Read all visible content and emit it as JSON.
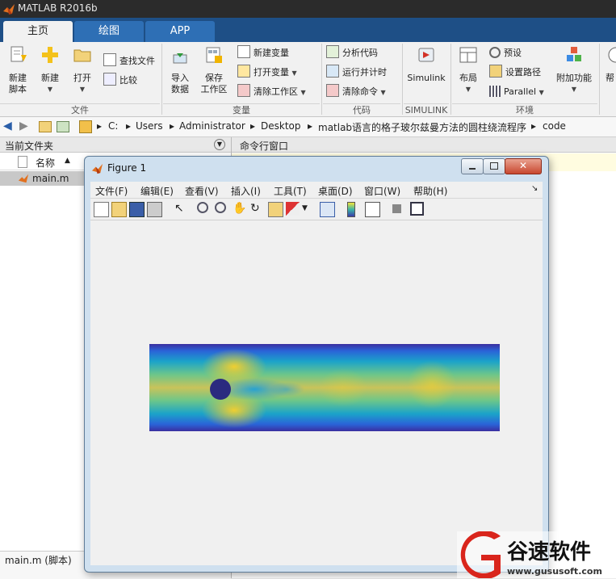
{
  "window": {
    "title": "MATLAB R2016b"
  },
  "tabs": [
    {
      "label": "主页",
      "active": true
    },
    {
      "label": "绘图",
      "active": false
    },
    {
      "label": "APP",
      "active": false
    }
  ],
  "ribbon": {
    "file": {
      "section_label": "文件",
      "new_script": [
        "新建",
        "脚本"
      ],
      "new": "新建",
      "open": "打开",
      "find_files": "查找文件",
      "compare": "比较"
    },
    "variable": {
      "section_label": "变量",
      "import_data": [
        "导入",
        "数据"
      ],
      "save_workspace": [
        "保存",
        "工作区"
      ],
      "new_variable": "新建变量",
      "open_variable": "打开变量",
      "clear_workspace": "清除工作区"
    },
    "code": {
      "section_label": "代码",
      "analyze_code": "分析代码",
      "run_and_time": "运行并计时",
      "clear_commands": "清除命令"
    },
    "simulink": {
      "section_label": "SIMULINK",
      "label": "Simulink"
    },
    "environment": {
      "section_label": "环境",
      "layout": "布局",
      "preferences": "预设",
      "set_path": "设置路径",
      "parallel": "Parallel",
      "addons": "附加功能"
    },
    "help_partial": "帮"
  },
  "address": {
    "crumbs": [
      "C:",
      "Users",
      "Administrator",
      "Desktop",
      "matlab语言的格子玻尔兹曼方法的圆柱绕流程序",
      "code"
    ]
  },
  "file_browser": {
    "title": "当前文件夹",
    "column_name": "名称",
    "sort_arrow": "▲",
    "files": [
      {
        "name": "main.m"
      }
    ],
    "footer": "main.m  (脚本)"
  },
  "command_window": {
    "title": "命令行窗口"
  },
  "figure": {
    "title": "Figure 1",
    "menu": [
      "文件(F)",
      "编辑(E)",
      "查看(V)",
      "插入(I)",
      "工具(T)",
      "桌面(D)",
      "窗口(W)",
      "帮助(H)"
    ],
    "menu_dock_arrow": "↘",
    "toolbar_icons": [
      "new-figure-icon",
      "open-file-icon",
      "save-icon",
      "print-icon",
      "pointer-icon",
      "zoom-in-icon",
      "zoom-out-icon",
      "pan-icon",
      "rotate-icon",
      "data-cursor-icon",
      "brush-icon",
      "link-icon",
      "colorbar-icon",
      "legend-icon",
      "hide-plot-tools-icon",
      "show-plot-tools-icon"
    ]
  },
  "watermark": {
    "brand": "谷速软件",
    "url": "www.gususoft.com"
  },
  "colors": {
    "matlab_blue": "#1e4f86",
    "tab_blue": "#2e6fb5",
    "watermark_red": "#d9251c"
  }
}
